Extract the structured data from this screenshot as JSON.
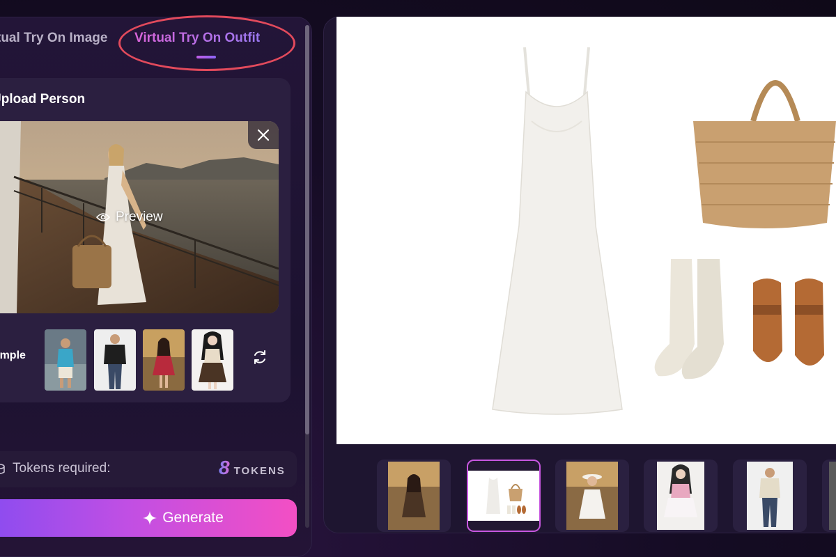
{
  "tabs": {
    "image_label": "Virtual Try On Image",
    "outfit_label": "Virtual Try On Outfit",
    "active": "outfit"
  },
  "upload": {
    "title": "Upload Person",
    "preview_label": "Preview"
  },
  "samples": {
    "label": "Sample",
    "items": [
      "sample-1",
      "sample-2",
      "sample-3",
      "sample-4"
    ]
  },
  "tokens": {
    "label": "Tokens required:",
    "value": "8",
    "unit": "TOKENS"
  },
  "generate": {
    "label": "Generate"
  },
  "history": {
    "selected_index": 1,
    "count": 6
  },
  "colors": {
    "accent_pink": "#f34fc4",
    "accent_purple": "#8a4cf0",
    "highlight_red": "#e24a5c",
    "panel_bg": "#1e1530"
  }
}
